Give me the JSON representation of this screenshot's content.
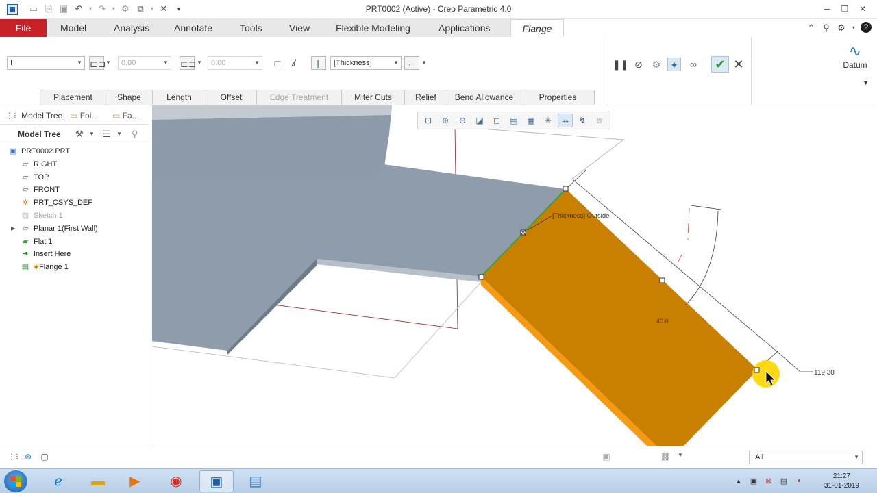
{
  "window": {
    "title": "PRT0002 (Active) - Creo Parametric 4.0",
    "quick_access_icons": [
      "new-icon",
      "open-icon",
      "save-icon",
      "undo-icon",
      "redo-icon",
      "regenerate-icon",
      "windows-icon",
      "close-window-icon",
      "customize-icon"
    ],
    "controls": [
      "minimize",
      "restore",
      "close"
    ]
  },
  "ribbon": {
    "tabs": [
      {
        "label": "File"
      },
      {
        "label": "Model"
      },
      {
        "label": "Analysis"
      },
      {
        "label": "Annotate"
      },
      {
        "label": "Tools"
      },
      {
        "label": "View"
      },
      {
        "label": "Flexible Modeling"
      },
      {
        "label": "Applications"
      },
      {
        "label": "Flange"
      }
    ],
    "active_tab": "Flange"
  },
  "dashboard": {
    "shape_combo": "I",
    "length1_value": "0.00",
    "length2_value": "0.00",
    "thickness_combo": "[Thickness]",
    "datum_label": "Datum"
  },
  "subtabs": [
    {
      "label": "Placement",
      "enabled": true
    },
    {
      "label": "Shape",
      "enabled": true
    },
    {
      "label": "Length",
      "enabled": true
    },
    {
      "label": "Offset",
      "enabled": true
    },
    {
      "label": "Edge Treatment",
      "enabled": false
    },
    {
      "label": "Miter Cuts",
      "enabled": true
    },
    {
      "label": "Relief",
      "enabled": true
    },
    {
      "label": "Bend Allowance",
      "enabled": true
    },
    {
      "label": "Properties",
      "enabled": true
    }
  ],
  "leftpane": {
    "tab_model_tree": "Model Tree",
    "tab_folder": "Fol...",
    "tab_favorites": "Fa...",
    "header": "Model Tree",
    "tree": [
      {
        "label": "PRT0002.PRT",
        "icon": "part-icon",
        "greyed": false
      },
      {
        "label": "RIGHT",
        "icon": "datum-plane-icon",
        "greyed": false
      },
      {
        "label": "TOP",
        "icon": "datum-plane-icon",
        "greyed": false
      },
      {
        "label": "FRONT",
        "icon": "datum-plane-icon",
        "greyed": false
      },
      {
        "label": "PRT_CSYS_DEF",
        "icon": "csys-icon",
        "greyed": false
      },
      {
        "label": "Sketch 1",
        "icon": "sketch-icon",
        "greyed": true
      },
      {
        "label": "Planar 1(First Wall)",
        "icon": "planar-wall-icon",
        "greyed": false,
        "expandable": true
      },
      {
        "label": "Flat 1",
        "icon": "flat-wall-icon",
        "greyed": false
      },
      {
        "label": "Insert Here",
        "icon": "insert-arrow-icon",
        "greyed": false
      },
      {
        "label": "Flange 1",
        "icon": "flange-icon",
        "greyed": false
      }
    ]
  },
  "graphics": {
    "annotation_thickness": "[Thickness] Outside",
    "dim_angle": "40.0",
    "dim_length": "119.30",
    "colors": {
      "flange_face": "#c98000",
      "flange_edge": "#f59a12",
      "wall_top": "#8f9cab",
      "wall_side": "#6f7d8b",
      "attach_edge": "#3aa23a"
    }
  },
  "statusbar": {
    "filter_value": "All"
  },
  "taskbar": {
    "apps": [
      "internet-explorer",
      "file-explorer",
      "media-player",
      "chrome",
      "creo",
      "creo-document"
    ],
    "time": "21:27",
    "date": "31-01-2019"
  }
}
